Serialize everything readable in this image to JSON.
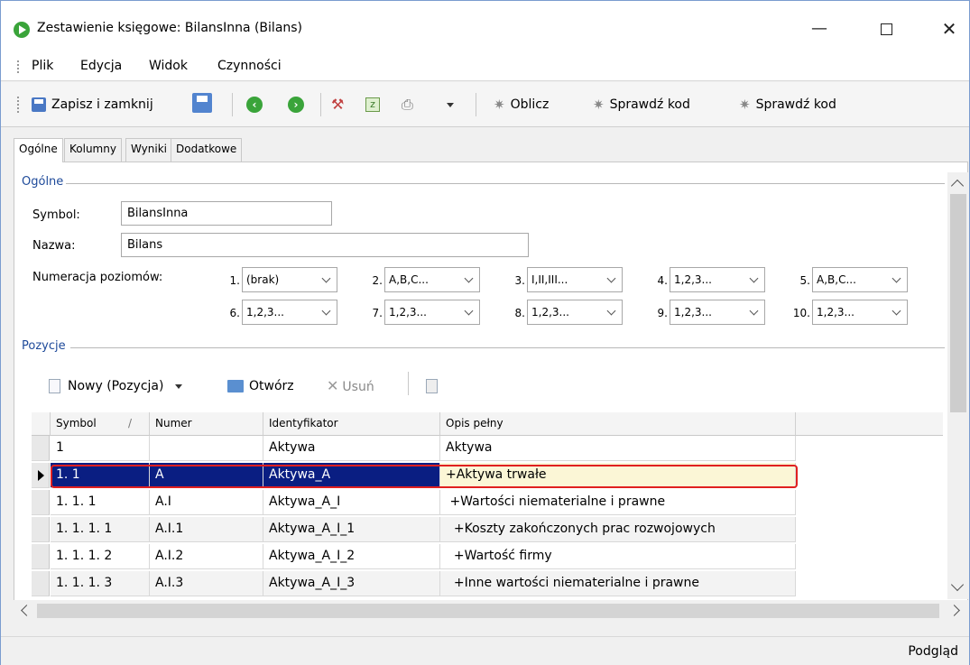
{
  "window": {
    "title": "Zestawienie księgowe: BilansInna (Bilans)",
    "minimize": "—",
    "close": "✕"
  },
  "menu": [
    "Plik",
    "Edycja",
    "Widok",
    "Czynności"
  ],
  "toolbar": {
    "save_close": "Zapisz i zamknij",
    "calculate": "Oblicz",
    "check_code_1": "Sprawdź kod",
    "check_code_2": "Sprawdź kod"
  },
  "tabs": [
    "Ogólne",
    "Kolumny",
    "Wyniki",
    "Dodatkowe"
  ],
  "general": {
    "group": "Ogólne",
    "symbol_label": "Symbol:",
    "symbol_value": "BilansInna",
    "name_label": "Nazwa:",
    "name_value": "Bilans",
    "levels_label": "Numeracja poziomów:",
    "levels": [
      {
        "num": "1.",
        "value": "(brak)"
      },
      {
        "num": "2.",
        "value": "A,B,C..."
      },
      {
        "num": "3.",
        "value": "I,II,III..."
      },
      {
        "num": "4.",
        "value": "1,2,3..."
      },
      {
        "num": "5.",
        "value": "A,B,C..."
      },
      {
        "num": "6.",
        "value": "1,2,3..."
      },
      {
        "num": "7.",
        "value": "1,2,3..."
      },
      {
        "num": "8.",
        "value": "1,2,3..."
      },
      {
        "num": "9.",
        "value": "1,2,3..."
      },
      {
        "num": "10.",
        "value": "1,2,3..."
      }
    ]
  },
  "positions": {
    "group": "Pozycje",
    "new": "Nowy (Pozycja)",
    "open": "Otwórz",
    "delete": "Usuń"
  },
  "grid": {
    "columns": [
      "Symbol",
      "Numer",
      "Identyfikator",
      "Opis pełny"
    ],
    "sort_indicator": "/",
    "rows": [
      [
        "1",
        "",
        "Aktywa",
        "Aktywa"
      ],
      [
        "1. 1",
        "A",
        "Aktywa_A",
        "+Aktywa trwałe"
      ],
      [
        "1. 1. 1",
        "A.I",
        "Aktywa_A_I",
        " +Wartości niematerialne i prawne"
      ],
      [
        "1. 1. 1. 1",
        "A.I.1",
        "Aktywa_A_I_1",
        "  +Koszty zakończonych prac rozwojowych"
      ],
      [
        "1. 1. 1. 2",
        "A.I.2",
        "Aktywa_A_I_2",
        "  +Wartość firmy"
      ],
      [
        "1. 1. 1. 3",
        "A.I.3",
        "Aktywa_A_I_3",
        "  +Inne wartości niematerialne i prawne"
      ]
    ],
    "selected_row": 1
  },
  "status": "Podgląd"
}
